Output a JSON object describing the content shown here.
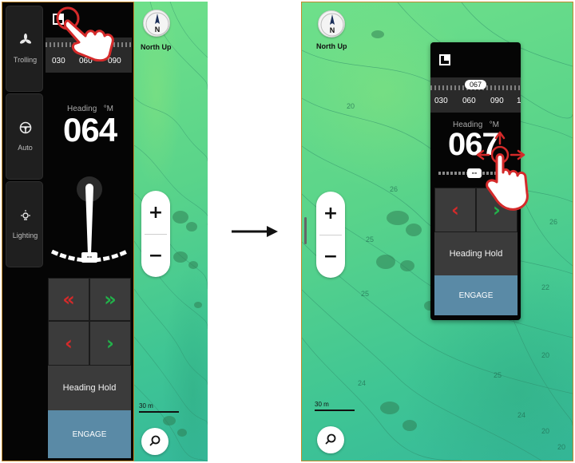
{
  "left": {
    "sidebar": [
      {
        "label": "Trolling",
        "icon": "propeller-icon"
      },
      {
        "label": "Auto",
        "icon": "steering-wheel-icon"
      },
      {
        "label": "Lighting",
        "icon": "lightbulb-icon"
      }
    ],
    "tape": [
      "030",
      "060",
      "090"
    ],
    "heading": {
      "label": "Heading",
      "unit": "°M",
      "value": "064"
    },
    "rudder_center": "--",
    "controls": {
      "port_fast": "«",
      "stbd_fast": "»",
      "port": "‹",
      "stbd": "›",
      "heading_hold": "Heading Hold",
      "engage": "ENGAGE"
    }
  },
  "map": {
    "compass_letter": "N",
    "orientation": "North Up",
    "zoom_in": "+",
    "zoom_out": "−",
    "scale": "30 m",
    "depth_labels": [
      "20",
      "25",
      "25",
      "24",
      "20"
    ]
  },
  "right": {
    "tape": [
      "030",
      "060",
      "090",
      "1"
    ],
    "target_heading": "067",
    "heading": {
      "label": "Heading",
      "unit": "°M",
      "value": "067"
    },
    "rudder_center": "--",
    "controls": {
      "port": "‹",
      "stbd": "›",
      "heading_hold": "Heading Hold",
      "engage": "ENGAGE"
    },
    "map_depth_labels": [
      "20",
      "26",
      "25",
      "25",
      "24",
      "26",
      "22",
      "20",
      "25",
      "24",
      "20",
      "20"
    ]
  },
  "colors": {
    "accent_red": "#d42a2a",
    "accent_green": "#22b24a",
    "engage_blue": "#5a8aa6",
    "frame_orange": "#c48a2a"
  }
}
